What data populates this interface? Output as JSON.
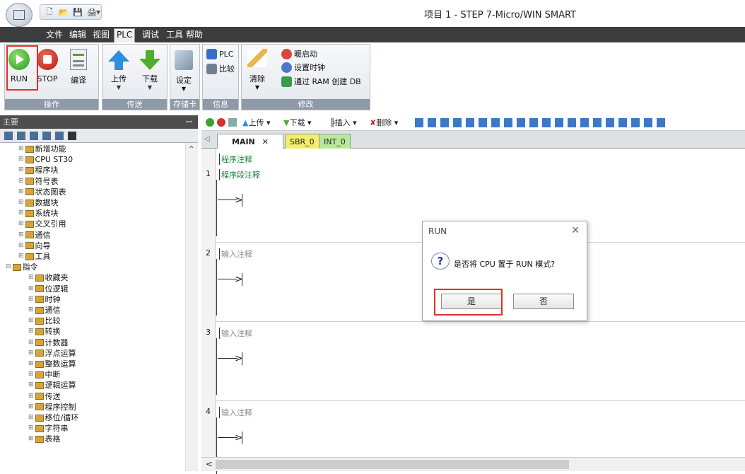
{
  "app": {
    "title": "项目 1 - STEP 7-Micro/WIN SMART"
  },
  "menu": [
    "文件",
    "编辑",
    "视图",
    "PLC",
    "调试",
    "工具",
    "帮助"
  ],
  "ribbon": {
    "groups": [
      "操作",
      "传送",
      "存储卡",
      "信息",
      "修改"
    ],
    "buttons": {
      "run": "RUN",
      "stop": "STOP",
      "compile": "编译",
      "upload": "上传",
      "download": "下载",
      "setup": "设定",
      "plc": "PLC",
      "compare": "比较",
      "clear": "清除",
      "warm_start": "暖启动",
      "set_clock": "设置时钟",
      "create_db": "通过 RAM 创建 DB"
    }
  },
  "left": {
    "header": "主要",
    "pin": "ꟷ",
    "tree": [
      {
        "label": "新增功能",
        "indent": 1
      },
      {
        "label": "CPU ST30",
        "indent": 1
      },
      {
        "label": "程序块",
        "indent": 1
      },
      {
        "label": "符号表",
        "indent": 1
      },
      {
        "label": "状态图表",
        "indent": 1
      },
      {
        "label": "数据块",
        "indent": 1
      },
      {
        "label": "系统块",
        "indent": 1
      },
      {
        "label": "交叉引用",
        "indent": 1
      },
      {
        "label": "通信",
        "indent": 1
      },
      {
        "label": "向导",
        "indent": 1
      },
      {
        "label": "工具",
        "indent": 1
      },
      {
        "label": "指令",
        "indent": 0
      },
      {
        "label": "收藏夹",
        "indent": 2
      },
      {
        "label": "位逻辑",
        "indent": 2
      },
      {
        "label": "时钟",
        "indent": 2
      },
      {
        "label": "通信",
        "indent": 2
      },
      {
        "label": "比较",
        "indent": 2
      },
      {
        "label": "转换",
        "indent": 2
      },
      {
        "label": "计数器",
        "indent": 2
      },
      {
        "label": "浮点运算",
        "indent": 2
      },
      {
        "label": "整数运算",
        "indent": 2
      },
      {
        "label": "中断",
        "indent": 2
      },
      {
        "label": "逻辑运算",
        "indent": 2
      },
      {
        "label": "传送",
        "indent": 2
      },
      {
        "label": "程序控制",
        "indent": 2
      },
      {
        "label": "移位/循环",
        "indent": 2
      },
      {
        "label": "字符串",
        "indent": 2
      },
      {
        "label": "表格",
        "indent": 2
      }
    ]
  },
  "editor_toolbar": {
    "upload": "上传",
    "download": "下载",
    "insert": "插入",
    "delete": "删除"
  },
  "tabs": {
    "main": "MAIN",
    "close": "✕",
    "sbr": "SBR_0",
    "int": "INT_0"
  },
  "editor": {
    "program_comment": "程序注释",
    "networks": [
      {
        "num": "1",
        "comment": "程序段注释"
      },
      {
        "num": "2",
        "comment": "输入注释"
      },
      {
        "num": "3",
        "comment": "输入注释"
      },
      {
        "num": "4",
        "comment": "输入注释"
      }
    ]
  },
  "dialog": {
    "title": "RUN",
    "close": "✕",
    "message": "是否将 CPU 置于 RUN 模式?",
    "yes": "是",
    "no": "否",
    "icon": "?"
  }
}
